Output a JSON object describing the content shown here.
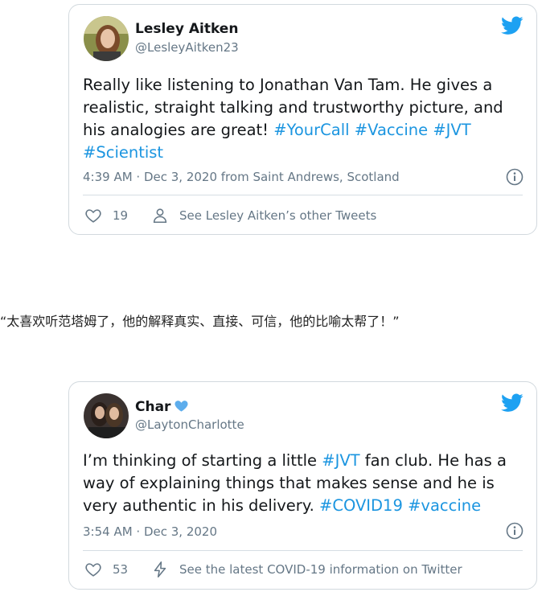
{
  "tweets": [
    {
      "author_name": "Lesley Aitken",
      "handle": "@LesleyAitken23",
      "text_parts": [
        "Really like listening to Jonathan Van Tam. He gives a realistic, straight talking and trustworthy picture, and his analogies are great! ",
        "#YourCall",
        " ",
        "#Vaccine",
        " ",
        "#JVT",
        " ",
        "#Scientist"
      ],
      "timestamp": "4:39 AM · Dec 3, 2020 from Saint Andrews, Scotland",
      "like_count": "19",
      "secondary_action": "See Lesley Aitken’s other Tweets"
    },
    {
      "author_name": "Char",
      "handle": "@LaytonCharlotte",
      "text_parts": [
        "I’m thinking of starting a little ",
        "#JVT",
        " fan club. He has a way of explaining things that makes sense and he is very authentic in his delivery. ",
        "#COVID19",
        " ",
        "#vaccine"
      ],
      "timestamp": "3:54 AM · Dec 3, 2020",
      "like_count": "53",
      "secondary_action": "See the latest COVID-19 information on Twitter"
    }
  ],
  "quote_translation": "“太喜欢听范塔姆了，他的解释真实、直接、可信，他的比喻太帮了！”",
  "colors": {
    "brand": "#1da1f2",
    "hashtag": "#1b95e0",
    "muted": "#657786",
    "border": "#d2d9de"
  }
}
